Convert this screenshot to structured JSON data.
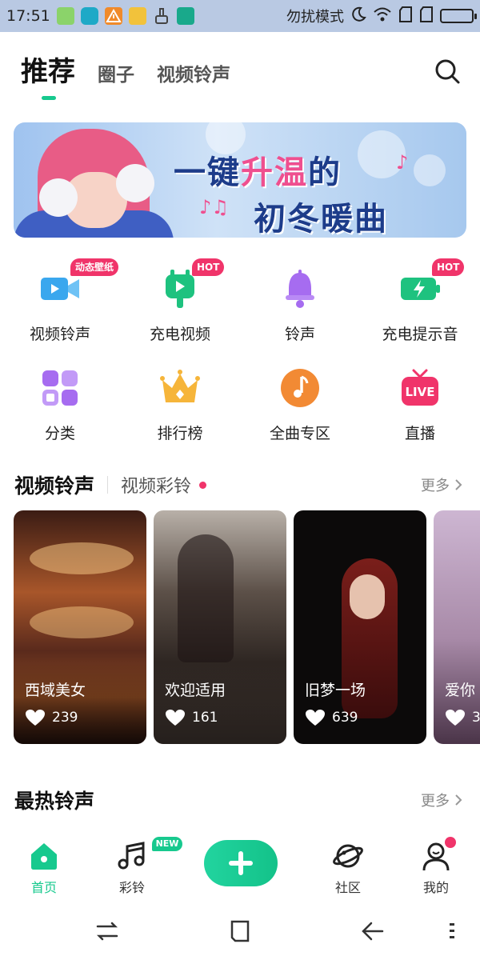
{
  "status_bar": {
    "time": "17:51",
    "dnd_text": "勿扰模式",
    "app_icons": [
      "android-icon",
      "swirl-app-icon",
      "warning-icon",
      "folder-icon",
      "broom-icon",
      "usb-icon"
    ],
    "bg_color": "#b9c9e3"
  },
  "top_nav": {
    "tabs": [
      {
        "label": "推荐",
        "active": true
      },
      {
        "label": "圈子",
        "active": false
      },
      {
        "label": "视频铃声",
        "active": false
      }
    ],
    "accent": "#17c98e"
  },
  "banner": {
    "line1_a": "一键",
    "line1_b": "升温",
    "line1_c": "的",
    "line2": "初冬暖曲",
    "notes": "♪♫"
  },
  "categories": [
    {
      "label": "视频铃声",
      "badge": "动态壁纸",
      "icon": "video-camera-icon"
    },
    {
      "label": "充电视频",
      "badge": "HOT",
      "icon": "charge-video-icon"
    },
    {
      "label": "铃声",
      "badge": "",
      "icon": "bell-icon"
    },
    {
      "label": "充电提示音",
      "badge": "HOT",
      "icon": "battery-bolt-icon"
    },
    {
      "label": "分类",
      "badge": "",
      "icon": "grid-icon"
    },
    {
      "label": "排行榜",
      "badge": "",
      "icon": "crown-icon"
    },
    {
      "label": "全曲专区",
      "badge": "",
      "icon": "music-note-icon"
    },
    {
      "label": "直播",
      "badge": "",
      "icon": "live-tv-icon",
      "icon_text": "LIVE"
    }
  ],
  "video_section": {
    "title": "视频铃声",
    "subtitle": "视频彩铃",
    "more": "更多",
    "cards": [
      {
        "title": "西域美女",
        "likes": "239"
      },
      {
        "title": "欢迎适用",
        "likes": "161"
      },
      {
        "title": "旧梦一场",
        "likes": "639"
      },
      {
        "title": "爱你",
        "likes": "3"
      }
    ]
  },
  "hot_section": {
    "title": "最热铃声",
    "more": "更多"
  },
  "bottom_nav": {
    "items": [
      {
        "label": "首页",
        "active": true,
        "icon": "home-icon"
      },
      {
        "label": "彩铃",
        "active": false,
        "icon": "music-notes-icon",
        "badge": "NEW"
      },
      {
        "label": "",
        "active": false,
        "icon": "plus-icon"
      },
      {
        "label": "社区",
        "active": false,
        "icon": "planet-icon"
      },
      {
        "label": "我的",
        "active": false,
        "icon": "profile-icon"
      }
    ]
  }
}
